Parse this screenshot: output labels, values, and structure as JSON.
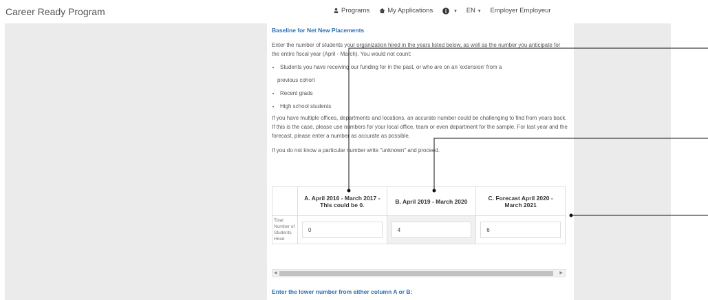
{
  "navbar": {
    "brand": "Career Ready Program",
    "programs": "Programs",
    "my_applications": "My Applications",
    "language": "EN",
    "user": "Employer Employeur",
    "caret": "▾"
  },
  "section": {
    "heading": "Baseline for Net New Placements",
    "intro": "Enter the number of students your organization hired in the years listed below, as well as the number you anticipate for the entire fiscal year (April - March). You would not count:",
    "bullets": [
      "Students you have receiving our funding for in the past, or who are on an 'extension' from a",
      "previous cohort",
      "Recent grads",
      "High school students"
    ],
    "para2": "If you have multiple offices, departments and locations, an accurate number could be challenging to find from years back. If this is the case, please use numbers for your local office, team or even department for the sample. For last year and the forecast, please enter a number as accurate as possible.",
    "para3": "If you do not know a particular number write \"unknown\" and proceed."
  },
  "table": {
    "columns": [
      "A. April 2016 - March 2017 - This could be 0.",
      "B. April 2019 - March 2020",
      "C. Forecast April 2020 - March 2021"
    ],
    "row_label": "Total Number of Students Hired",
    "values": [
      "0",
      "4",
      "6"
    ]
  },
  "scroll": {
    "left_arrow": "◀",
    "right_arrow": "▶"
  },
  "footer_heading": "Enter the lower number from either column A or B:"
}
